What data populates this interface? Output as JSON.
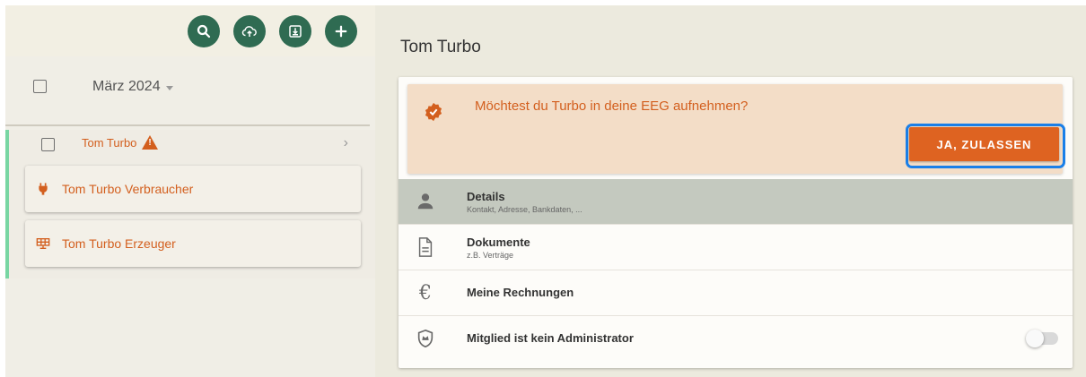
{
  "toolbar": {
    "buttons": [
      {
        "icon": "search-icon"
      },
      {
        "icon": "cloud-upload-icon"
      },
      {
        "icon": "download-icon"
      },
      {
        "icon": "plus-icon"
      }
    ],
    "accent_color": "#2f6b52"
  },
  "list": {
    "period_label": "März 2024",
    "member": {
      "name": "Tom Turbo",
      "warning_icon": "warning-icon",
      "meters": [
        {
          "label": "Tom Turbo Verbraucher",
          "icon": "plug-icon"
        },
        {
          "label": "Tom Turbo Erzeuger",
          "icon": "solar-panel-icon"
        }
      ]
    }
  },
  "detail": {
    "title": "Tom Turbo",
    "banner": {
      "text": "Möchtest du Turbo in deine EEG aufnehmen?",
      "button_label": "JA, ZULASSEN",
      "color": "#d35f1e"
    },
    "rows": [
      {
        "title": "Details",
        "subtitle": "Kontakt, Adresse, Bankdaten, ...",
        "icon": "person-icon"
      },
      {
        "title": "Dokumente",
        "subtitle": "z.B. Verträge",
        "icon": "document-icon"
      },
      {
        "title": "Meine Rechnungen",
        "icon": "euro-icon",
        "glyph": "€"
      },
      {
        "title": "Mitglied ist kein Administrator",
        "icon": "shield-crown-icon"
      }
    ],
    "admin_toggle": false
  }
}
